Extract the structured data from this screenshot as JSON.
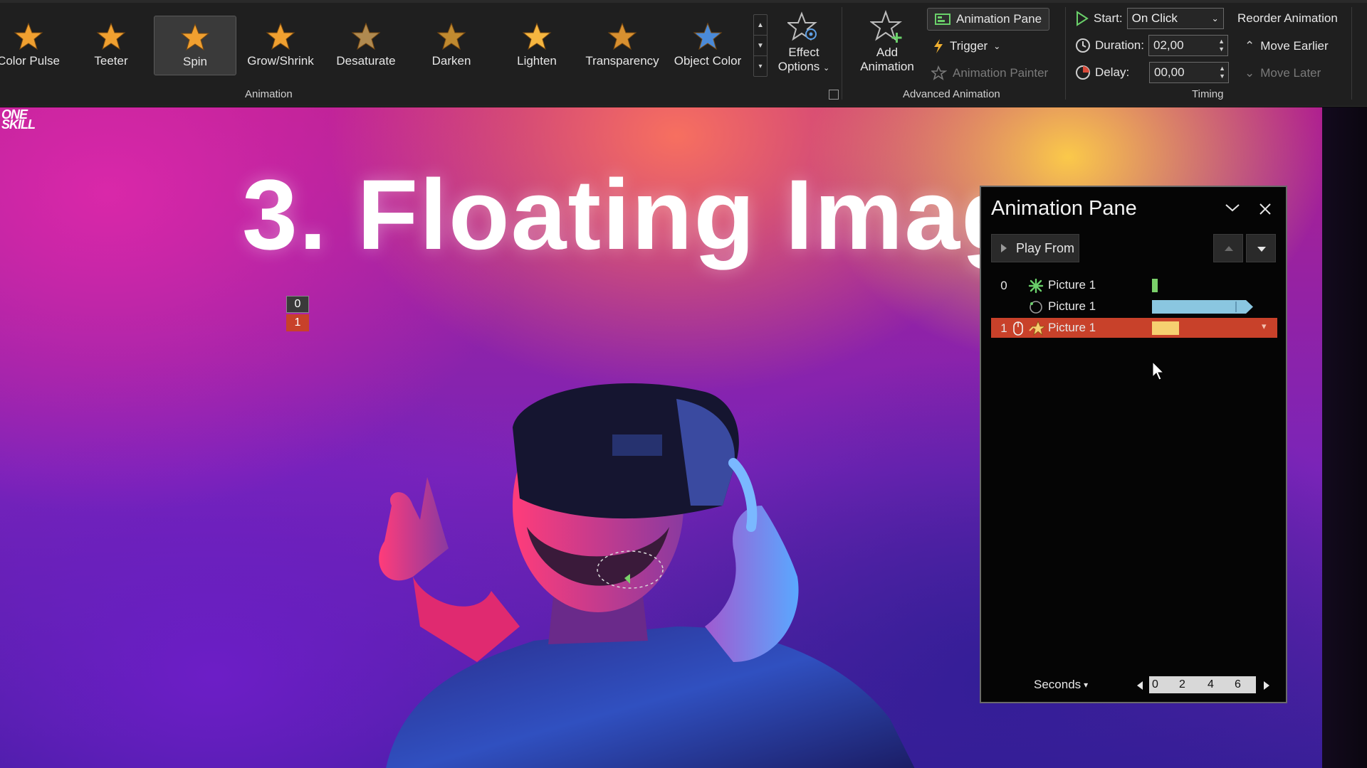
{
  "ribbon": {
    "effects": [
      {
        "label": "Color Pulse",
        "icon": "star-color-pulse-icon",
        "color": "#f0a030"
      },
      {
        "label": "Teeter",
        "icon": "star-teeter-icon",
        "color": "#f0a030"
      },
      {
        "label": "Spin",
        "icon": "star-spin-icon",
        "color": "#f0a030",
        "selected": true
      },
      {
        "label": "Grow/Shrink",
        "icon": "star-grow-shrink-icon",
        "color": "#f0a030"
      },
      {
        "label": "Desaturate",
        "icon": "star-desaturate-icon",
        "color": "#b08a50"
      },
      {
        "label": "Darken",
        "icon": "star-darken-icon",
        "color": "#c08a30"
      },
      {
        "label": "Lighten",
        "icon": "star-lighten-icon",
        "color": "#f6b640"
      },
      {
        "label": "Transparency",
        "icon": "star-transparency-icon",
        "color": "#d89030"
      },
      {
        "label": "Object Color",
        "icon": "star-object-color-icon",
        "color": "#4a8ad8"
      }
    ],
    "effect_options_label": "Effect Options",
    "animation_group_label": "Animation",
    "add_animation_label": "Add Animation",
    "animation_pane_label": "Animation Pane",
    "trigger_label": "Trigger",
    "animation_painter_label": "Animation Painter",
    "advanced_group_label": "Advanced Animation",
    "start_label": "Start:",
    "start_value": "On Click",
    "duration_label": "Duration:",
    "duration_value": "02,00",
    "delay_label": "Delay:",
    "delay_value": "00,00",
    "reorder_label": "Reorder Animation",
    "move_earlier_label": "Move Earlier",
    "move_later_label": "Move Later",
    "timing_group_label": "Timing"
  },
  "slide": {
    "logo_line1": "ONE",
    "logo_line2": "SKILL",
    "title": "3. Floating Imag",
    "tag0": "0",
    "tag1": "1"
  },
  "pane": {
    "title": "Animation Pane",
    "play_from_label": "Play From",
    "rows": [
      {
        "num": "0",
        "name": "Picture 1",
        "icon": "entrance-burst-icon",
        "bar_color": "#7ad06a",
        "selected": false
      },
      {
        "num": "",
        "name": "Picture 1",
        "icon": "motion-path-circle-icon",
        "bar_color": "#8ac6e0",
        "selected": false
      },
      {
        "num": "1",
        "name": "Picture 1",
        "icon": "emphasis-star-icon",
        "bar_color": "#f6d070",
        "selected": true
      }
    ],
    "seconds_label": "Seconds",
    "scale_ticks": [
      "0",
      "2",
      "4",
      "6"
    ]
  },
  "colors": {
    "ribbon_bg": "#1f1f1f",
    "selection": "#c8412a",
    "pane_bg": "#050505"
  }
}
